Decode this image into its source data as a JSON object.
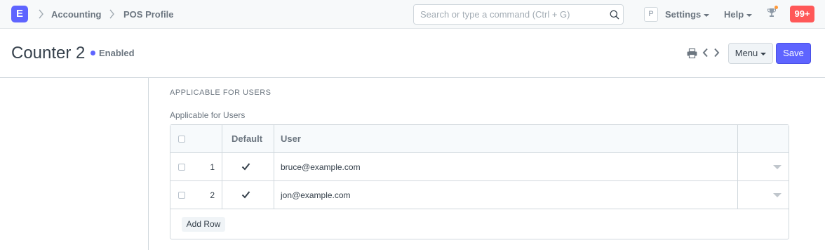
{
  "navbar": {
    "logo_letter": "E",
    "breadcrumbs": [
      "Accounting",
      "POS Profile"
    ],
    "search_placeholder": "Search or type a command (Ctrl + G)",
    "avatar_letter": "P",
    "settings_label": "Settings",
    "help_label": "Help",
    "notification_count": "99+"
  },
  "page": {
    "title": "Counter 2",
    "status": "Enabled",
    "menu_label": "Menu",
    "save_label": "Save"
  },
  "section": {
    "title": "APPLICABLE FOR USERS",
    "field_label": "Applicable for Users",
    "table": {
      "headers": {
        "default": "Default",
        "user": "User"
      },
      "rows": [
        {
          "index": "1",
          "default": true,
          "user": "bruce@example.com"
        },
        {
          "index": "2",
          "default": true,
          "user": "jon@example.com"
        }
      ],
      "add_row_label": "Add Row"
    }
  },
  "colors": {
    "accent": "#5e64ff",
    "badge": "#ff5858",
    "notification_dot": "#ff9a3a"
  }
}
